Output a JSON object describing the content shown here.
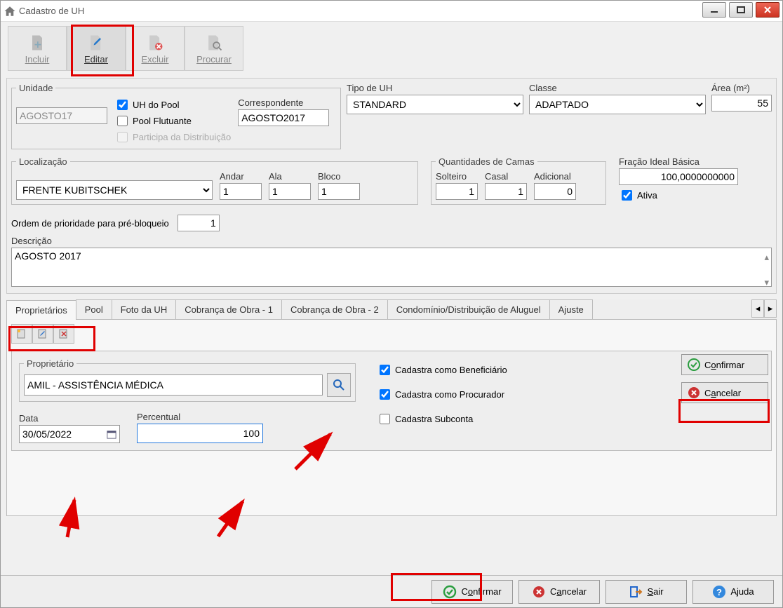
{
  "window": {
    "title": "Cadastro de UH"
  },
  "toolbar": {
    "incluir": "Incluir",
    "editar": "Editar",
    "excluir": "Excluir",
    "procurar": "Procurar"
  },
  "unidade": {
    "legend": "Unidade",
    "value": "AGOSTO17",
    "uh_pool_label": "UH do Pool",
    "pool_flut_label": "Pool Flutuante",
    "participa_label": "Participa da Distribuição",
    "correspondente_label": "Correspondente",
    "correspondente_value": "AGOSTO2017"
  },
  "tipo_uh": {
    "label": "Tipo de UH",
    "value": "STANDARD"
  },
  "classe": {
    "label": "Classe",
    "value": "ADAPTADO"
  },
  "area": {
    "label": "Área (m²)",
    "value": "55"
  },
  "localizacao": {
    "legend": "Localização",
    "value": "FRENTE KUBITSCHEK",
    "andar_label": "Andar",
    "andar": "1",
    "ala_label": "Ala",
    "ala": "1",
    "bloco_label": "Bloco",
    "bloco": "1"
  },
  "camas": {
    "legend": "Quantidades de Camas",
    "solteiro_label": "Solteiro",
    "solteiro": "1",
    "casal_label": "Casal",
    "casal": "1",
    "adicional_label": "Adicional",
    "adicional": "0"
  },
  "fracao": {
    "label": "Fração Ideal Básica",
    "value": "100,0000000000"
  },
  "ativa_label": "Ativa",
  "ordem": {
    "label": "Ordem de prioridade para pré-bloqueio",
    "value": "1"
  },
  "descricao": {
    "label": "Descrição",
    "value": "AGOSTO 2017"
  },
  "tabs": {
    "proprietarios": "Proprietários",
    "pool": "Pool",
    "foto": "Foto da UH",
    "cob1": "Cobrança de Obra - 1",
    "cob2": "Cobrança de Obra - 2",
    "cond": "Condomínio/Distribuição de Aluguel",
    "ajuste": "Ajuste"
  },
  "proprietario_form": {
    "legend": "Proprietário",
    "value": "AMIL - ASSISTÊNCIA MÉDICA",
    "data_label": "Data",
    "data_value": "30/05/2022",
    "percentual_label": "Percentual",
    "percentual_value": "100",
    "cad_benef": "Cadastra como Beneficiário",
    "cad_proc": "Cadastra como Procurador",
    "cad_sub": "Cadastra Subconta"
  },
  "side": {
    "confirmar": "Confirmar",
    "cancelar": "Cancelar"
  },
  "bottom": {
    "confirmar": "Confirmar",
    "cancelar": "Cancelar",
    "sair": "Sair",
    "ajuda": "Ajuda"
  }
}
